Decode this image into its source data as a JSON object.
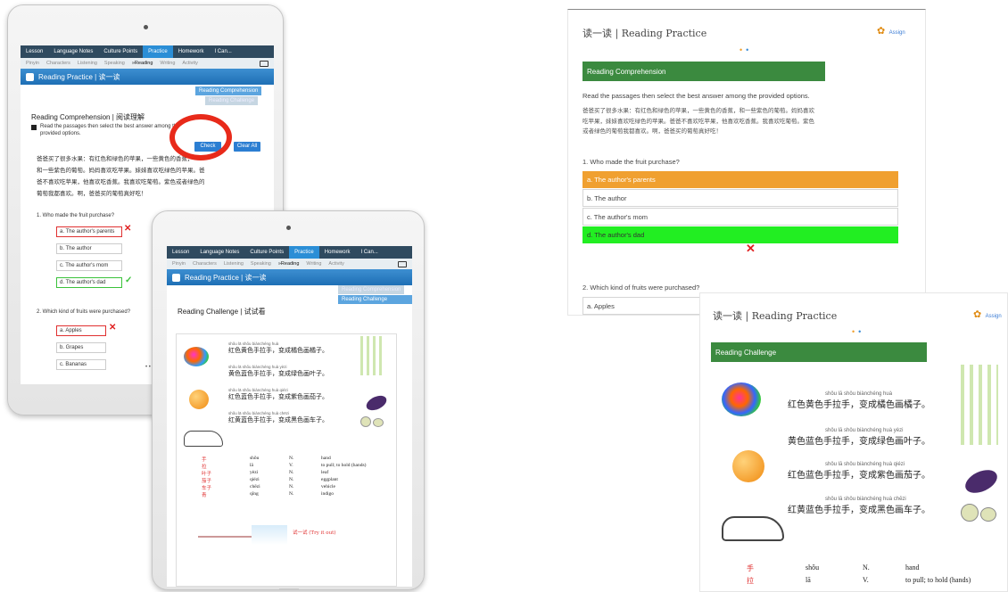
{
  "nav": {
    "tabs": [
      "Lesson",
      "Language Notes",
      "Culture Points",
      "Practice",
      "Homework",
      "I Can..."
    ],
    "active_tab": "Practice",
    "subtabs": [
      "Pinyin",
      "Characters",
      "Listening",
      "Speaking",
      "»Reading",
      "Writing",
      "Activity"
    ]
  },
  "tablet1": {
    "title": "Reading Practice | 读一读",
    "tab_comprehension": "Reading Comprehension",
    "tab_challenge": "Reading Challenge",
    "section_heading": "Reading Comprehension | 阅读理解",
    "instruction_line1": "Read the passages then select the best answer among the",
    "instruction_line2": "provided options.",
    "check_label": "Check",
    "clear_label": "Clear All",
    "passage_lines": [
      "爸爸买了很多水果：有红色和绿色的苹果，一些黄色的香蕉，",
      "和一些紫色的葡萄。妈妈喜欢吃苹果。妹妹喜欢吃绿色的苹果。爸",
      "爸不喜欢吃苹果，他喜欢吃香蕉。我喜欢吃葡萄。紫色或者绿色的",
      "葡萄我都喜欢。啊，爸爸买的葡萄真好吃！"
    ],
    "q1": "1.  Who made the fruit purchase?",
    "q1_options": [
      "a. The author's parents",
      "b. The author",
      "c. The author's mom",
      "d. The author's dad"
    ],
    "q2": "2.  Which kind of fruits were purchased?",
    "q2_options": [
      "a. Apples",
      "b. Grapes",
      "c. Bananas"
    ],
    "page_dots": "• •"
  },
  "tablet2": {
    "title": "Reading Practice | 读一读",
    "tab_comprehension": "Reading Comprehension",
    "tab_challenge": "Reading Challenge",
    "section_heading": "Reading Challenge | 试试看",
    "try_it": "试一试 (Try it out)"
  },
  "web1": {
    "title": "读一读 | Reading Practice",
    "assign": "Assign",
    "page_dots": "• •",
    "section": "Reading Comprehension",
    "instruction": "Read the passages then select the best answer among the provided options.",
    "passage_lines": [
      "爸爸买了很多水果：有红色和绿色的苹果，一些黄色的香蕉，和一些紫色的葡萄。妈妈喜欢",
      "吃苹果，妹妹喜欢吃绿色的苹果。爸爸不喜欢吃苹果，他喜欢吃香蕉。我喜欢吃葡萄。紫色",
      "或者绿色的葡萄我都喜欢。啊，爸爸买的葡萄真好吃！"
    ],
    "q1": "1. Who made the fruit purchase?",
    "q1_options": [
      "a. The author's parents",
      "b. The author",
      "c. The author's mom",
      "d. The author's dad"
    ],
    "q2": "2. Which kind of fruits were purchased?",
    "q2_first_option": "a. Apples"
  },
  "web2": {
    "title": "读一读 | Reading Practice",
    "assign": "Assign",
    "page_dots": "• •",
    "section": "Reading Challenge",
    "verses": [
      {
        "pinyin": "shǒu lā shǒu   biànchéng   huà",
        "hanzi": "红色黄色手拉手，变成橘色画橘子。"
      },
      {
        "pinyin": "shǒu lā shǒu   biànchéng   huà yèzi",
        "hanzi": "黄色蓝色手拉手，变成绿色画叶子。"
      },
      {
        "pinyin": "shǒu lā shǒu   biànchéng   huà qiézi",
        "hanzi": "红色蓝色手拉手，变成紫色画茄子。"
      },
      {
        "pinyin": "shǒu lā shǒu   biànchéng   huà chēzi",
        "hanzi": "红黄蓝色手拉手，变成黑色画车子。"
      }
    ],
    "vocab": [
      {
        "char": "手",
        "pinyin": "shǒu",
        "pos": "N.",
        "meaning": "hand"
      },
      {
        "char": "拉",
        "pinyin": "lā",
        "pos": "V.",
        "meaning": "to pull; to hold (hands)"
      }
    ]
  },
  "tablet2_vocab": [
    {
      "char": "手",
      "pinyin": "shǒu",
      "pos": "N.",
      "meaning": "hand"
    },
    {
      "char": "拉",
      "pinyin": "lā",
      "pos": "V.",
      "meaning": "to pull; to hold (hands)"
    },
    {
      "char": "叶子",
      "pinyin": "yèzi",
      "pos": "N.",
      "meaning": "leaf"
    },
    {
      "char": "茄子",
      "pinyin": "qiézi",
      "pos": "N.",
      "meaning": "eggplant"
    },
    {
      "char": "车子",
      "pinyin": "chēzi",
      "pos": "N.",
      "meaning": "vehicle"
    },
    {
      "char": "青",
      "pinyin": "qīng",
      "pos": "N.",
      "meaning": "indigo"
    }
  ],
  "colors": {
    "nav": "#2f4a5f",
    "active": "#2b8ed6",
    "green_bar": "#3b8a3f",
    "orange": "#f0a030",
    "lime": "#22ee22",
    "highlight_ring": "#e82a1a"
  }
}
